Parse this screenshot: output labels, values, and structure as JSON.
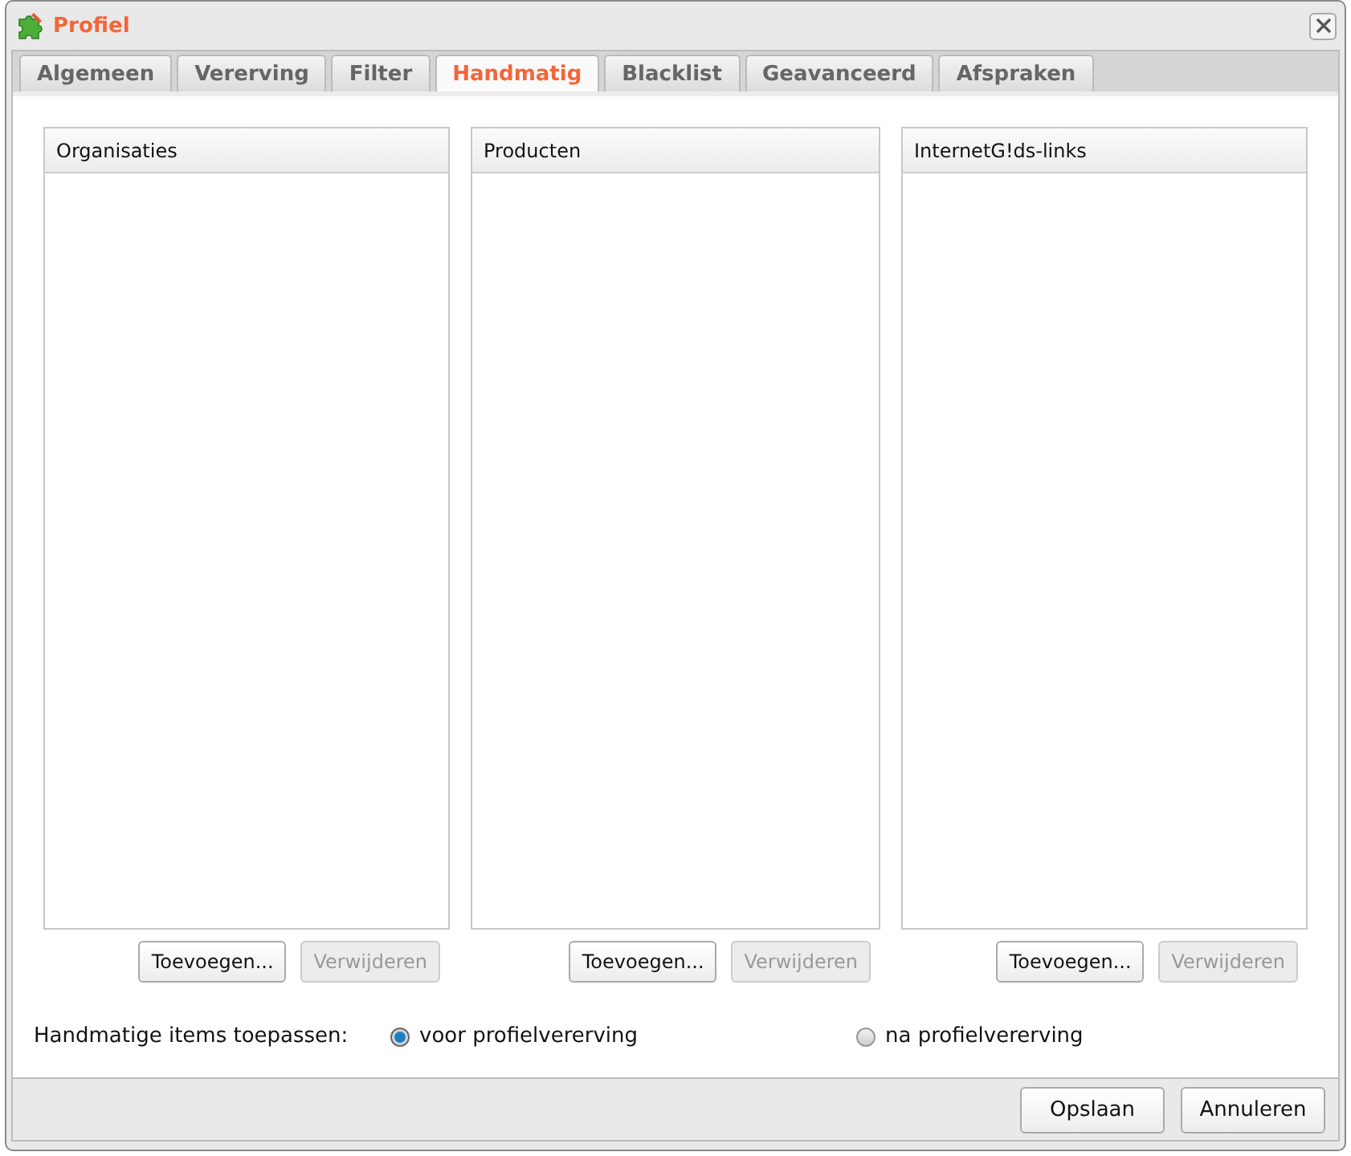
{
  "window": {
    "title": "Profiel"
  },
  "tabs": [
    {
      "label": "Algemeen",
      "selected": false
    },
    {
      "label": "Vererving",
      "selected": false
    },
    {
      "label": "Filter",
      "selected": false
    },
    {
      "label": "Handmatig",
      "selected": true
    },
    {
      "label": "Blacklist",
      "selected": false
    },
    {
      "label": "Geavanceerd",
      "selected": false
    },
    {
      "label": "Afspraken",
      "selected": false
    }
  ],
  "lists": [
    {
      "header": "Organisaties",
      "buttons": [
        {
          "label": "Toevoegen...",
          "disabled": false
        },
        {
          "label": "Verwijderen",
          "disabled": true
        }
      ]
    },
    {
      "header": "Producten",
      "buttons": [
        {
          "label": "Toevoegen...",
          "disabled": false
        },
        {
          "label": "Verwijderen",
          "disabled": true
        }
      ]
    },
    {
      "header": "InternetG!ds-links",
      "buttons": [
        {
          "label": "Toevoegen...",
          "disabled": false
        },
        {
          "label": "Verwijderen",
          "disabled": true
        }
      ]
    }
  ],
  "apply": {
    "label": "Handmatige items toepassen:",
    "options": [
      {
        "label": "voor profielvererving",
        "selected": true
      },
      {
        "label": "na profielvererving",
        "selected": false
      }
    ]
  },
  "footer_buttons": [
    "Opslaan",
    "Annuleren"
  ]
}
